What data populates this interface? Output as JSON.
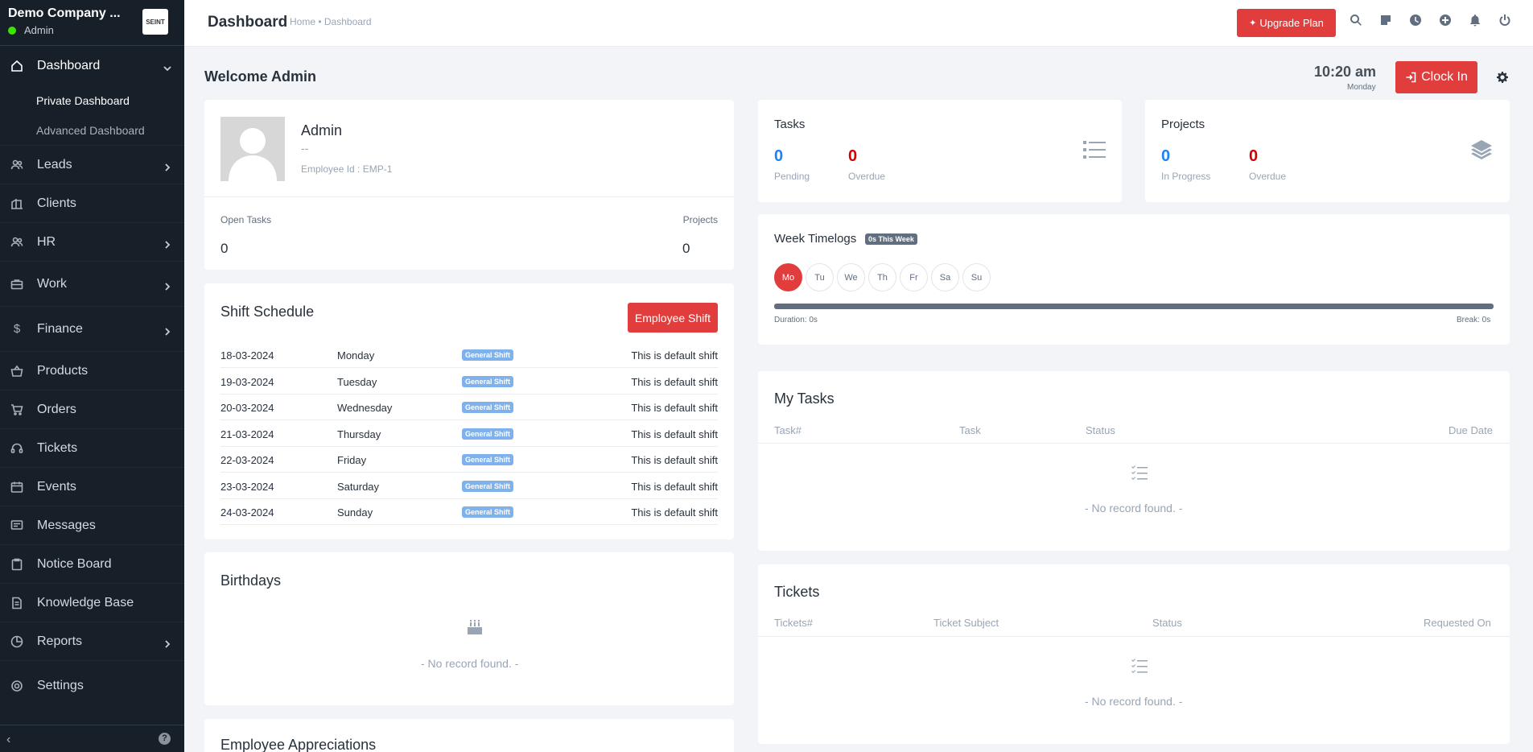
{
  "sidebar": {
    "company": "Demo Company ...",
    "logo_text": "SEINT",
    "role": "Admin",
    "items": [
      {
        "label": "Dashboard"
      },
      {
        "label": "Leads"
      },
      {
        "label": "Clients"
      },
      {
        "label": "HR"
      },
      {
        "label": "Work"
      },
      {
        "label": "Finance"
      },
      {
        "label": "Products"
      },
      {
        "label": "Orders"
      },
      {
        "label": "Tickets"
      },
      {
        "label": "Events"
      },
      {
        "label": "Messages"
      },
      {
        "label": "Notice Board"
      },
      {
        "label": "Knowledge Base"
      },
      {
        "label": "Reports"
      },
      {
        "label": "Settings"
      }
    ],
    "sub_items": [
      {
        "label": "Private Dashboard"
      },
      {
        "label": "Advanced Dashboard"
      }
    ],
    "help": "?"
  },
  "topbar": {
    "title": "Dashboard",
    "breadcrumb": "Home • Dashboard",
    "upgrade_label": "Upgrade Plan"
  },
  "header": {
    "welcome": "Welcome Admin",
    "time": "10:20 am",
    "day": "Monday",
    "clockin_label": "Clock In"
  },
  "profile": {
    "name": "Admin",
    "designation": "--",
    "employee_id": "Employee Id : EMP-1",
    "open_tasks_label": "Open Tasks",
    "open_tasks_value": "0",
    "projects_label": "Projects",
    "projects_value": "0"
  },
  "tasks_card": {
    "title": "Tasks",
    "pending_value": "0",
    "pending_label": "Pending",
    "overdue_value": "0",
    "overdue_label": "Overdue"
  },
  "projects_card": {
    "title": "Projects",
    "progress_value": "0",
    "progress_label": "In Progress",
    "overdue_value": "0",
    "overdue_label": "Overdue"
  },
  "timelogs": {
    "title": "Week Timelogs",
    "badge": "0s This Week",
    "days": [
      "Mo",
      "Tu",
      "We",
      "Th",
      "Fr",
      "Sa",
      "Su"
    ],
    "duration": "Duration: 0s",
    "break": "Break: 0s"
  },
  "shift": {
    "title": "Shift Schedule",
    "button_label": "Employee Shift",
    "rows": [
      {
        "date": "18-03-2024",
        "day": "Monday",
        "shift": "General Shift",
        "desc": "This is default shift"
      },
      {
        "date": "19-03-2024",
        "day": "Tuesday",
        "shift": "General Shift",
        "desc": "This is default shift"
      },
      {
        "date": "20-03-2024",
        "day": "Wednesday",
        "shift": "General Shift",
        "desc": "This is default shift"
      },
      {
        "date": "21-03-2024",
        "day": "Thursday",
        "shift": "General Shift",
        "desc": "This is default shift"
      },
      {
        "date": "22-03-2024",
        "day": "Friday",
        "shift": "General Shift",
        "desc": "This is default shift"
      },
      {
        "date": "23-03-2024",
        "day": "Saturday",
        "shift": "General Shift",
        "desc": "This is default shift"
      },
      {
        "date": "24-03-2024",
        "day": "Sunday",
        "shift": "General Shift",
        "desc": "This is default shift"
      }
    ]
  },
  "my_tasks": {
    "title": "My Tasks",
    "headers": [
      "Task#",
      "Task",
      "Status",
      "Due Date"
    ],
    "empty": "- No record found. -"
  },
  "birthdays": {
    "title": "Birthdays",
    "empty": "- No record found. -"
  },
  "tickets": {
    "title": "Tickets",
    "headers": [
      "Tickets#",
      "Ticket Subject",
      "Status",
      "Requested On"
    ],
    "empty": "- No record found. -"
  },
  "appreciations": {
    "title": "Employee Appreciations"
  },
  "colors": {
    "accent": "#e23d3d",
    "sidebar_bg": "#171f29",
    "blue": "#1d82f5",
    "red": "#d30000"
  }
}
